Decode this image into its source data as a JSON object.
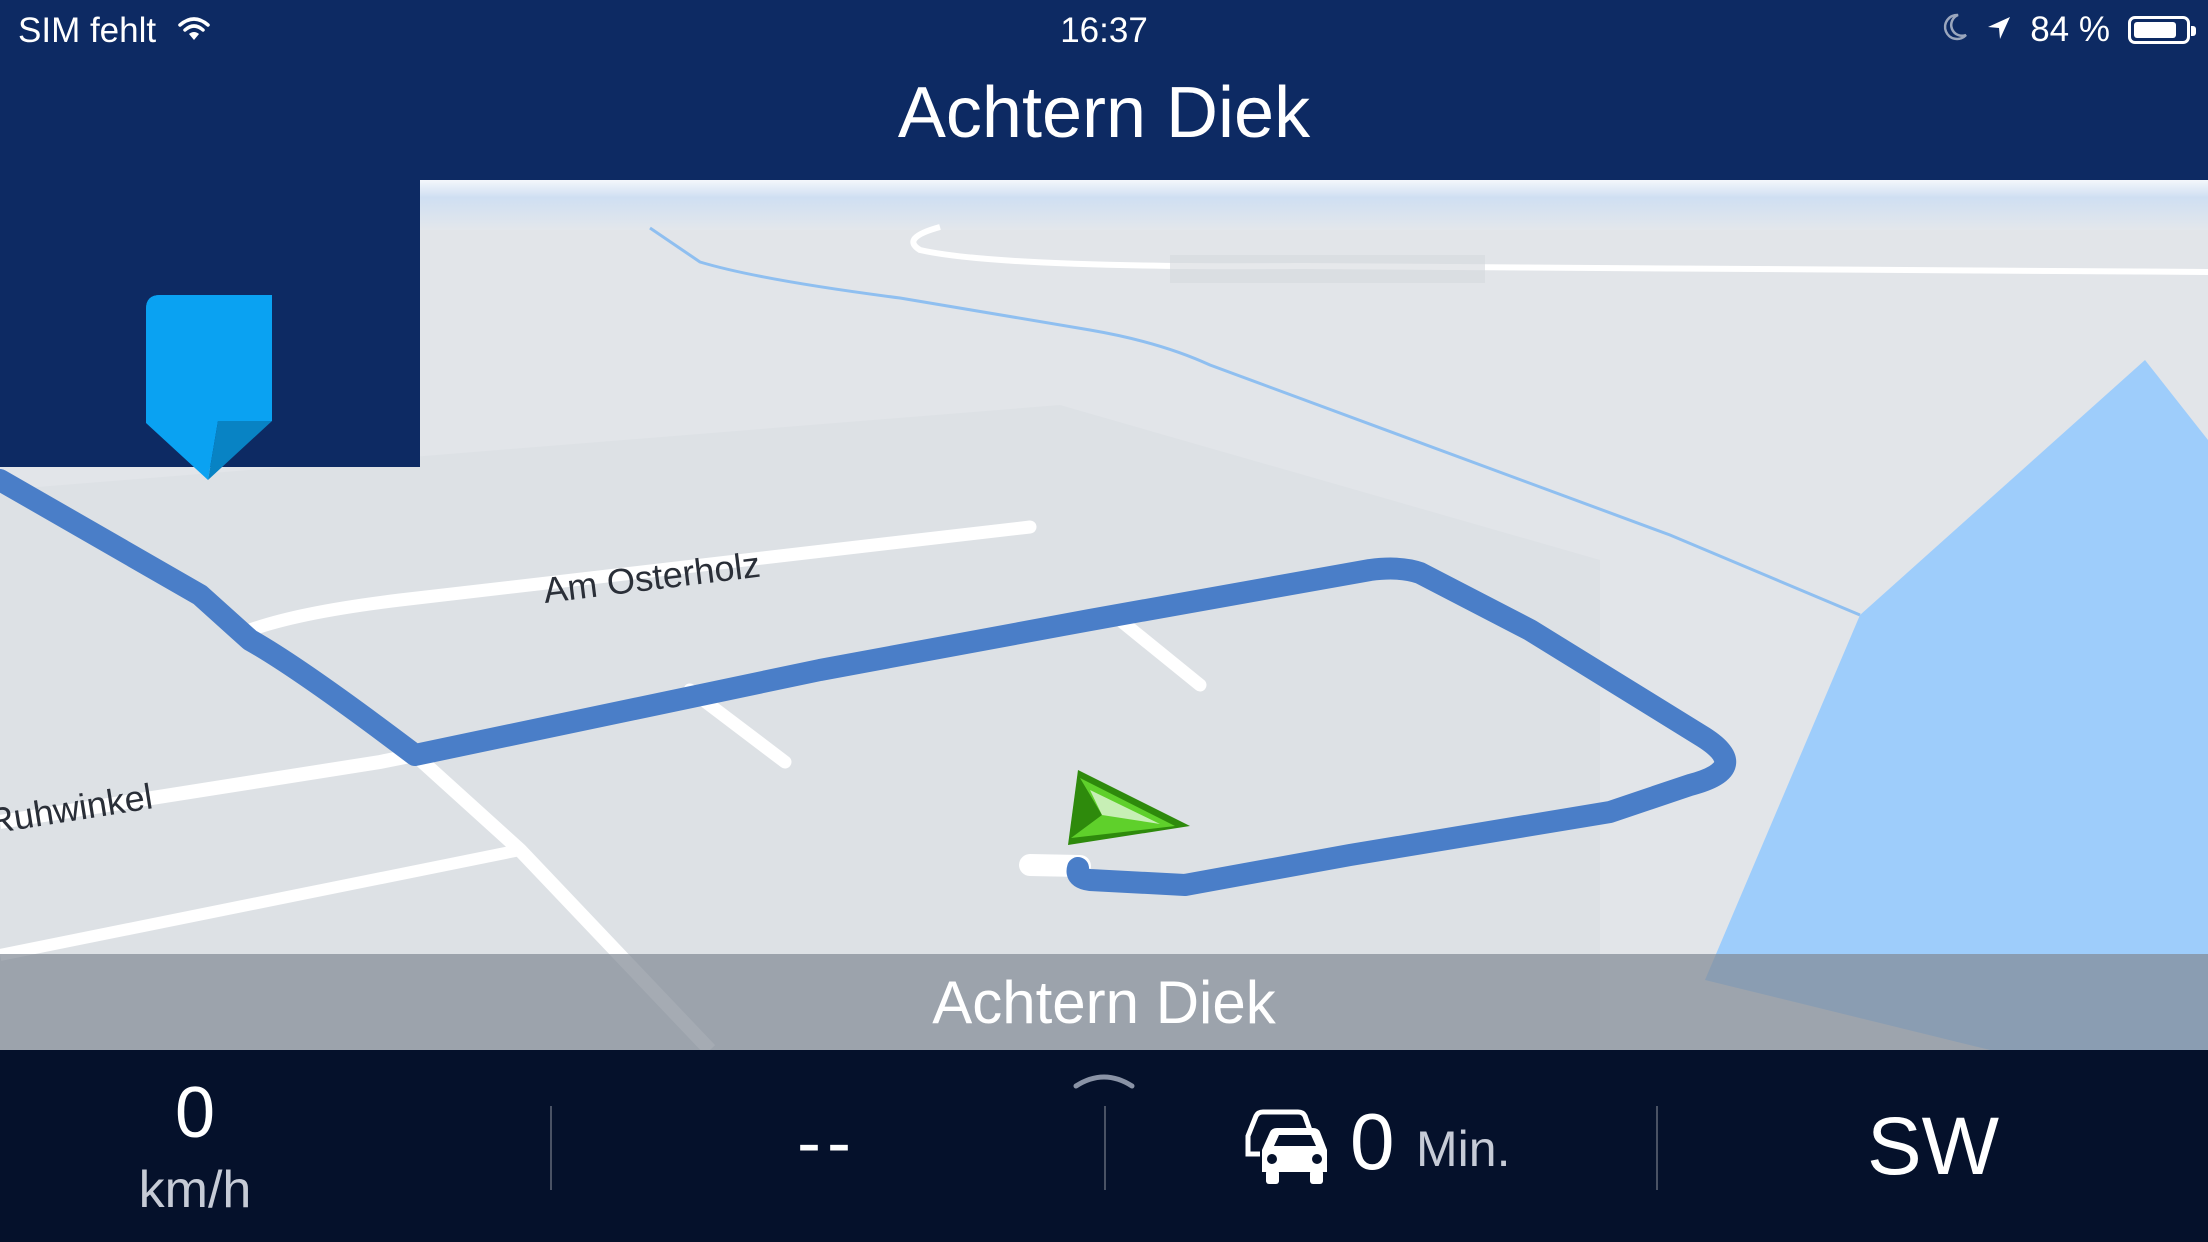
{
  "status_bar": {
    "carrier": "SIM fehlt",
    "time": "16:37",
    "battery_percent": "84 %",
    "battery_level": 0.84,
    "icons": [
      "wifi-icon",
      "moon-icon",
      "location-arrow-icon",
      "battery-icon"
    ]
  },
  "header": {
    "street_title": "Achtern Diek"
  },
  "map": {
    "street_labels": [
      "Am Osterholz",
      "Ruhwinkel"
    ],
    "current_street": "Achtern Diek",
    "colors": {
      "route": "#4a7ec8",
      "water": "#9ecdfb",
      "road": "#ffffff",
      "land": "#e2e5e9",
      "position_marker": "#4bbd1c"
    }
  },
  "bottom_bar": {
    "speed_value": "0",
    "speed_unit": "km/h",
    "distance_value": "--",
    "traffic_delay_value": "0",
    "traffic_delay_unit": "Min.",
    "heading": "SW"
  },
  "colors": {
    "header_bg": "#0d2a63",
    "bottom_bg": "#05112b",
    "speech_icon": "#0aa2f2"
  }
}
